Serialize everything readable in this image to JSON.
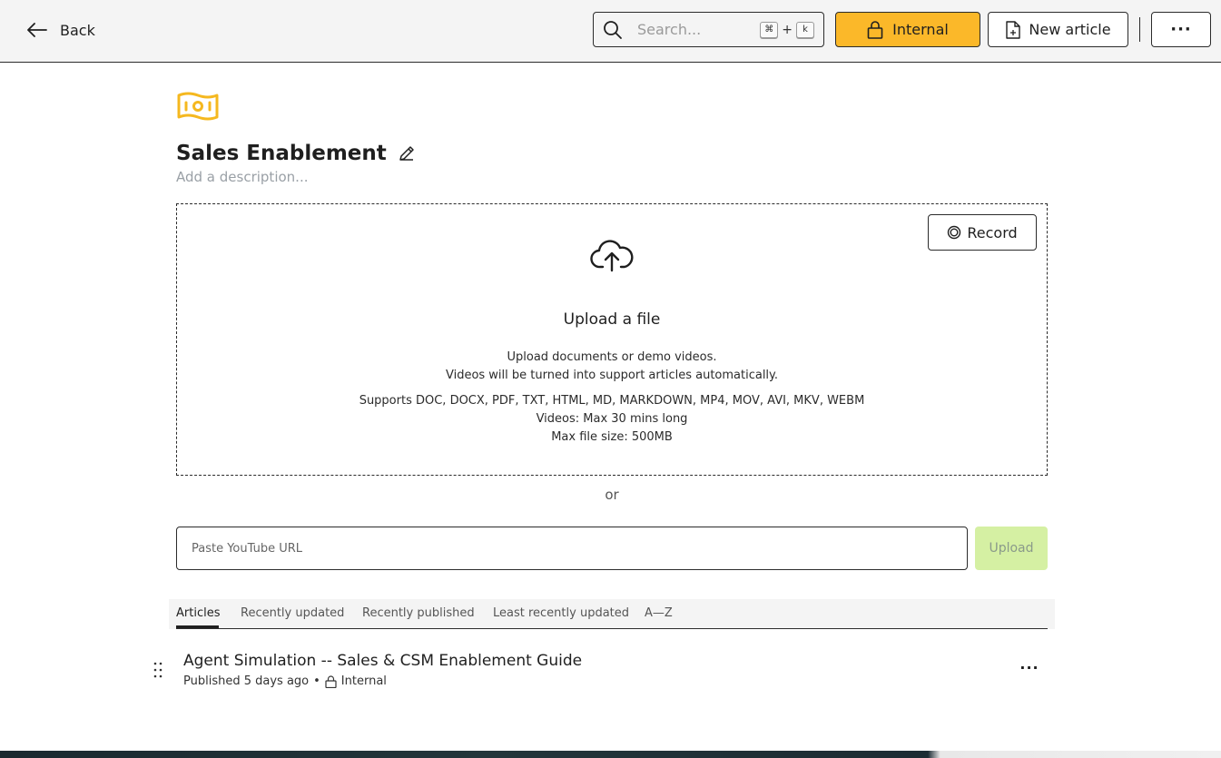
{
  "topbar": {
    "back_label": "Back",
    "search_placeholder": "Search...",
    "shortcut_mod": "⌘",
    "shortcut_plus": "+",
    "shortcut_key": "k",
    "internal_label": "Internal",
    "new_article_label": "New article",
    "more_label": "···"
  },
  "collection": {
    "title": "Sales Enablement",
    "description_placeholder": "Add a description...",
    "icon_color": "#f5b81f"
  },
  "upload": {
    "record_label": "Record",
    "title": "Upload a file",
    "line1": "Upload documents or demo videos.",
    "line2": "Videos will be turned into support articles automatically.",
    "line3": "Supports DOC, DOCX, PDF, TXT, HTML, MD, MARKDOWN, MP4, MOV, AVI, MKV, WEBM",
    "line4": "Videos: Max 30 mins long",
    "line5": "Max file size: 500MB",
    "or_label": "or",
    "youtube_placeholder": "Paste YouTube URL",
    "upload_button_label": "Upload"
  },
  "tabs": [
    {
      "label": "Articles",
      "active": true
    },
    {
      "label": "Recently updated",
      "active": false
    },
    {
      "label": "Recently published",
      "active": false
    },
    {
      "label": "Least recently updated",
      "active": false
    },
    {
      "label": "A—Z",
      "active": false
    }
  ],
  "articles": [
    {
      "title": "Agent Simulation -- Sales & CSM Enablement Guide",
      "published": "Published 5 days ago",
      "separator": "•",
      "visibility": "Internal",
      "more_label": "···"
    }
  ],
  "colors": {
    "accent_yellow": "#fbb829",
    "upload_disabled_green": "#d5f0a3"
  }
}
